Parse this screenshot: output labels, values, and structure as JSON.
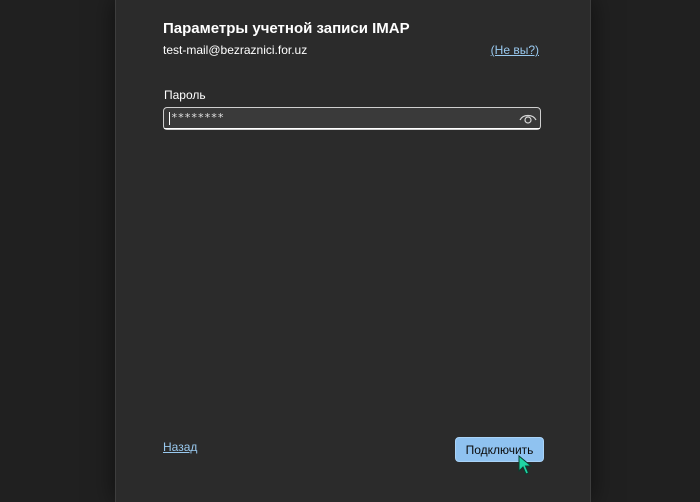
{
  "dialog": {
    "title": "Параметры учетной записи IMAP",
    "email": "test-mail@bezraznici.for.uz",
    "not_you_link": "(Не вы?)",
    "password": {
      "label": "Пароль",
      "value": "********",
      "reveal_icon": "eye-icon"
    },
    "back_link": "Назад",
    "connect_button": "Подключить"
  },
  "colors": {
    "accent": "#8fc2f0",
    "link": "#99c9ef",
    "dialog_bg": "#2b2b2b",
    "backdrop": "#202020"
  },
  "cursor_icon": "pointer-cursor-icon"
}
